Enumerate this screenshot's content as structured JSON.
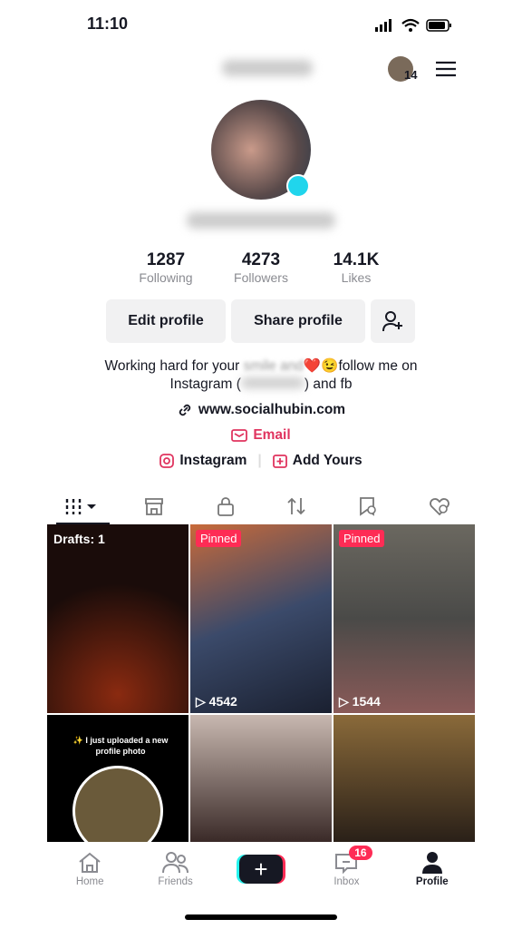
{
  "status": {
    "time": "11:10"
  },
  "header": {
    "friend_count": "14"
  },
  "stats": [
    {
      "value": "1287",
      "label": "Following"
    },
    {
      "value": "4273",
      "label": "Followers"
    },
    {
      "value": "14.1K",
      "label": "Likes"
    }
  ],
  "buttons": {
    "edit": "Edit profile",
    "share": "Share profile"
  },
  "bio": {
    "line1_start": "Working hard for your",
    "line1_end": "❤️😉follow me on",
    "line2_start": "Instagram (",
    "line2_end": ") and fb"
  },
  "link": "www.socialhubin.com",
  "email": "Email",
  "instagram": "Instagram",
  "add_yours": "Add Yours",
  "grid": [
    {
      "label": "Drafts: 1",
      "bg": "#2a1210"
    },
    {
      "badge": "Pinned",
      "views": "4542",
      "bg": "#3b4a6a"
    },
    {
      "badge": "Pinned",
      "views": "1544",
      "bg": "#6b6860"
    },
    {
      "caption": "✨ I just uploaded a new profile photo",
      "bg": "#000000"
    },
    {
      "bg": "#5a4a48"
    },
    {
      "bg": "#4a3a2a"
    }
  ],
  "nav": [
    {
      "label": "Home"
    },
    {
      "label": "Friends"
    },
    {
      "label": ""
    },
    {
      "label": "Inbox",
      "badge": "16"
    },
    {
      "label": "Profile"
    }
  ],
  "colors": {
    "accent": "#fe2c55",
    "email": "#e0345f"
  }
}
